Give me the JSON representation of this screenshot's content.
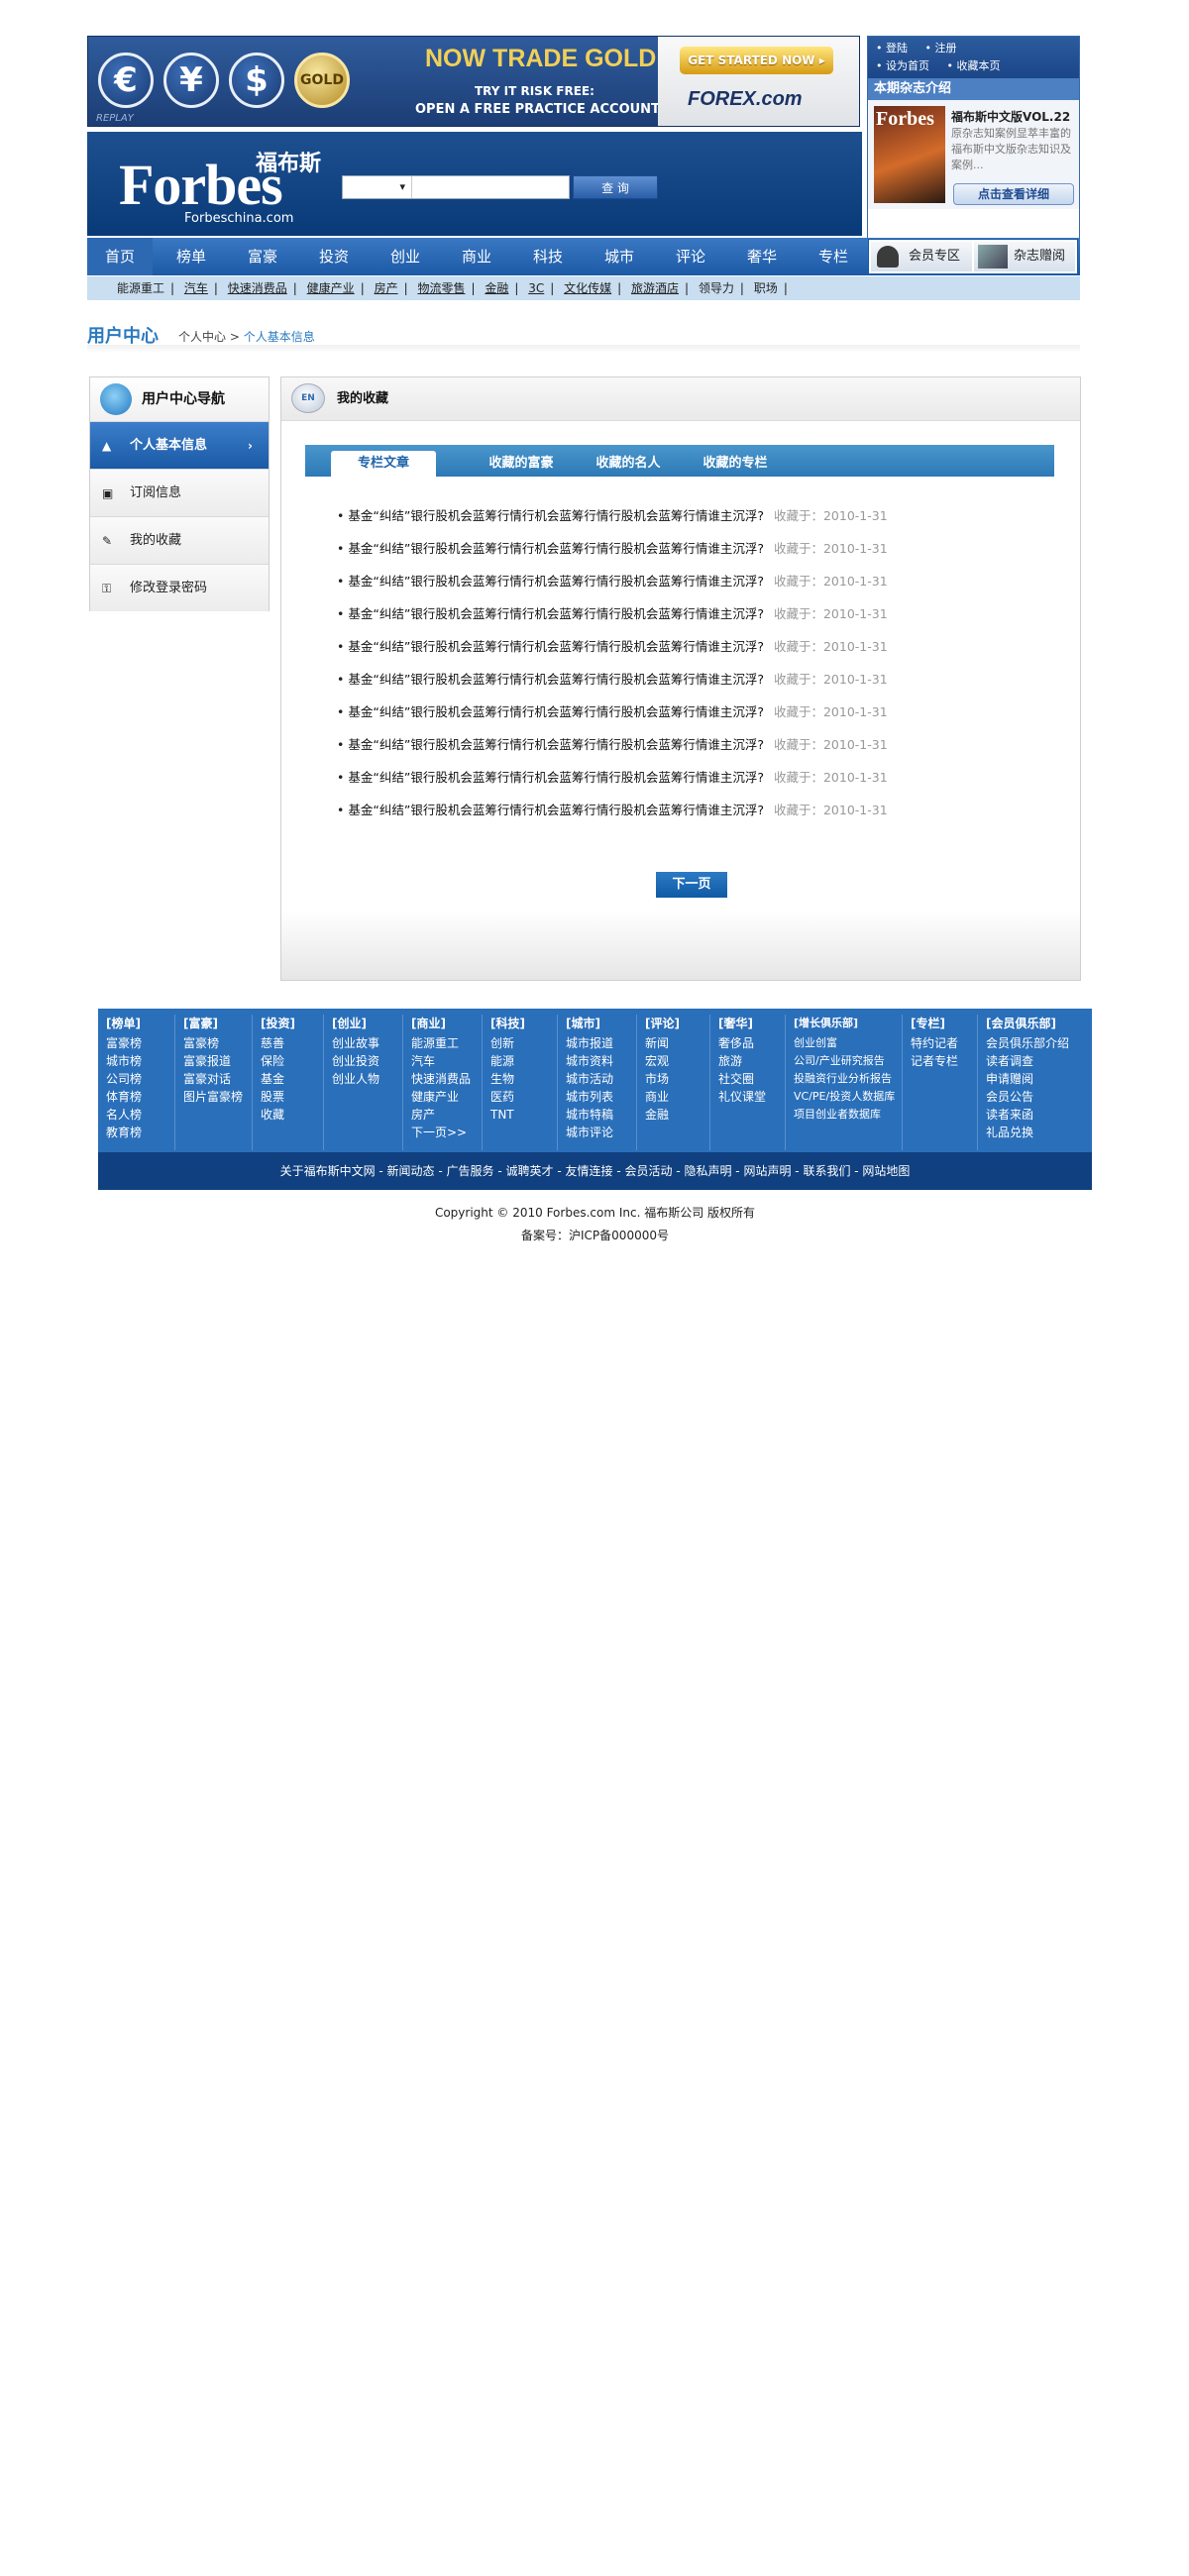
{
  "banner": {
    "coins": [
      "€",
      "¥",
      "$",
      "GOLD"
    ],
    "replay": "REPLAY",
    "title": "NOW TRADE GOLD",
    "sub1": "TRY IT RISK FREE:",
    "sub2": "OPEN A FREE PRACTICE ACCOUNT",
    "cta": "GET STARTED NOW ▸",
    "forex": "FOREX.com"
  },
  "header": {
    "logo_cn": "福布斯",
    "logo_en": "Forbes",
    "logo_domain": "Forbeschina.com",
    "search_select": "▾",
    "search_placeholder": "",
    "search_button": "查 询"
  },
  "right_panel": {
    "links": [
      "• 登陆",
      "• 注册",
      "• 设为首页",
      "• 收藏本页"
    ],
    "mag_heading": "本期杂志介绍",
    "mag_cover": "Forbes",
    "mag_title": "福布斯中文版VOL.22",
    "mag_desc": "原杂志知案例显萃丰富的福布斯中文版杂志知识及案例...",
    "mag_button": "点击查看详细"
  },
  "nav": {
    "items": [
      "首页",
      "榜单",
      "富豪",
      "投资",
      "创业",
      "商业",
      "科技",
      "城市",
      "评论",
      "奢华",
      "专栏"
    ],
    "member_zone": "会员专区",
    "magazine_gift": "杂志赠阅"
  },
  "subnav": {
    "items": [
      "能源重工",
      "汽车",
      "快速消费品",
      "健康产业",
      "房产",
      "物流零售",
      "金融",
      "3C",
      "文化传媒",
      "旅游酒店",
      "领导力",
      "职场"
    ]
  },
  "breadcrumb": {
    "title": "用户中心",
    "parent": "个人中心",
    "sep": ">",
    "current": "个人基本信息"
  },
  "sidebar": {
    "heading": "用户中心导航",
    "items": [
      {
        "label": "个人基本信息",
        "icon": "▲"
      },
      {
        "label": "订阅信息",
        "icon": "▣"
      },
      {
        "label": "我的收藏",
        "icon": "✎"
      },
      {
        "label": "修改登录密码",
        "icon": "⚿"
      }
    ],
    "active_arrow": "›"
  },
  "main": {
    "heading": "我的收藏",
    "icon_text": "EN",
    "tabs": [
      "专栏文章",
      "收藏的富豪",
      "收藏的名人",
      "收藏的专栏"
    ],
    "rows": [
      {
        "title": "基金“纠结”银行股机会蓝筹行情行机会蓝筹行情行股机会蓝筹行情谁主沉浮?",
        "date": "收藏于：2010-1-31"
      },
      {
        "title": "基金“纠结”银行股机会蓝筹行情行机会蓝筹行情行股机会蓝筹行情谁主沉浮?",
        "date": "收藏于：2010-1-31"
      },
      {
        "title": "基金“纠结”银行股机会蓝筹行情行机会蓝筹行情行股机会蓝筹行情谁主沉浮?",
        "date": "收藏于：2010-1-31"
      },
      {
        "title": "基金“纠结”银行股机会蓝筹行情行机会蓝筹行情行股机会蓝筹行情谁主沉浮?",
        "date": "收藏于：2010-1-31"
      },
      {
        "title": "基金“纠结”银行股机会蓝筹行情行机会蓝筹行情行股机会蓝筹行情谁主沉浮?",
        "date": "收藏于：2010-1-31"
      },
      {
        "title": "基金“纠结”银行股机会蓝筹行情行机会蓝筹行情行股机会蓝筹行情谁主沉浮?",
        "date": "收藏于：2010-1-31"
      },
      {
        "title": "基金“纠结”银行股机会蓝筹行情行机会蓝筹行情行股机会蓝筹行情谁主沉浮?",
        "date": "收藏于：2010-1-31"
      },
      {
        "title": "基金“纠结”银行股机会蓝筹行情行机会蓝筹行情行股机会蓝筹行情谁主沉浮?",
        "date": "收藏于：2010-1-31"
      },
      {
        "title": "基金“纠结”银行股机会蓝筹行情行机会蓝筹行情行股机会蓝筹行情谁主沉浮?",
        "date": "收藏于：2010-1-31"
      },
      {
        "title": "基金“纠结”银行股机会蓝筹行情行机会蓝筹行情行股机会蓝筹行情谁主沉浮?",
        "date": "收藏于：2010-1-31"
      }
    ],
    "next_button": "下一页"
  },
  "footer": {
    "columns": [
      {
        "heading": "[榜单]",
        "links": [
          "富豪榜",
          "城市榜",
          "公司榜",
          "体育榜",
          "名人榜",
          "教育榜"
        ]
      },
      {
        "heading": "[富豪]",
        "links": [
          "富豪榜",
          "富豪报道",
          "富豪对话",
          "图片富豪榜"
        ]
      },
      {
        "heading": "[投资]",
        "links": [
          "慈善",
          "保险",
          "基金",
          "股票",
          "收藏"
        ]
      },
      {
        "heading": "[创业]",
        "links": [
          "创业故事",
          "创业投资",
          "创业人物"
        ]
      },
      {
        "heading": "[商业]",
        "links": [
          "能源重工",
          "汽车",
          "快速消费品",
          "健康产业",
          "房产",
          "下一页>>"
        ]
      },
      {
        "heading": "[科技]",
        "links": [
          "创新",
          "能源",
          "生物",
          "医药",
          "TNT"
        ]
      },
      {
        "heading": "[城市]",
        "links": [
          "城市报道",
          "城市资料",
          "城市活动",
          "城市列表",
          "城市特稿",
          "城市评论"
        ]
      },
      {
        "heading": "[评论]",
        "links": [
          "新闻",
          "宏观",
          "市场",
          "商业",
          "金融"
        ]
      },
      {
        "heading": "[奢华]",
        "links": [
          "奢侈品",
          "旅游",
          "社交圈",
          "礼仪课堂"
        ]
      },
      {
        "heading": "[增长俱乐部]",
        "links": [
          "创业创富",
          "公司/产业研究报告",
          "投融资行业分析报告",
          "VC/PE/投资人数据库",
          "项目创业者数据库"
        ]
      },
      {
        "heading": "[专栏]",
        "links": [
          "特约记者",
          "记者专栏"
        ]
      },
      {
        "heading": "[会员俱乐部]",
        "links": [
          "会员俱乐部介绍",
          "读者调查",
          "申请赠阅",
          "会员公告",
          "读者来函",
          "礼品兑换"
        ]
      }
    ],
    "bottom_links": [
      "关于福布斯中文网",
      "新闻动态",
      "广告服务",
      "诚聘英才",
      "友情连接",
      "会员活动",
      "隐私声明",
      "网站声明",
      "联系我们",
      "网站地图"
    ],
    "copyright": "Copyright © 2010 Forbes.com Inc. 福布斯公司 版权所有",
    "icp": "备案号：沪ICP备000000号"
  },
  "colors": {
    "brand_blue": "#1c5aa6",
    "accent": "#2a7ac0",
    "footer_bg": "#2a6fba",
    "footer_bottom": "#10407f"
  }
}
